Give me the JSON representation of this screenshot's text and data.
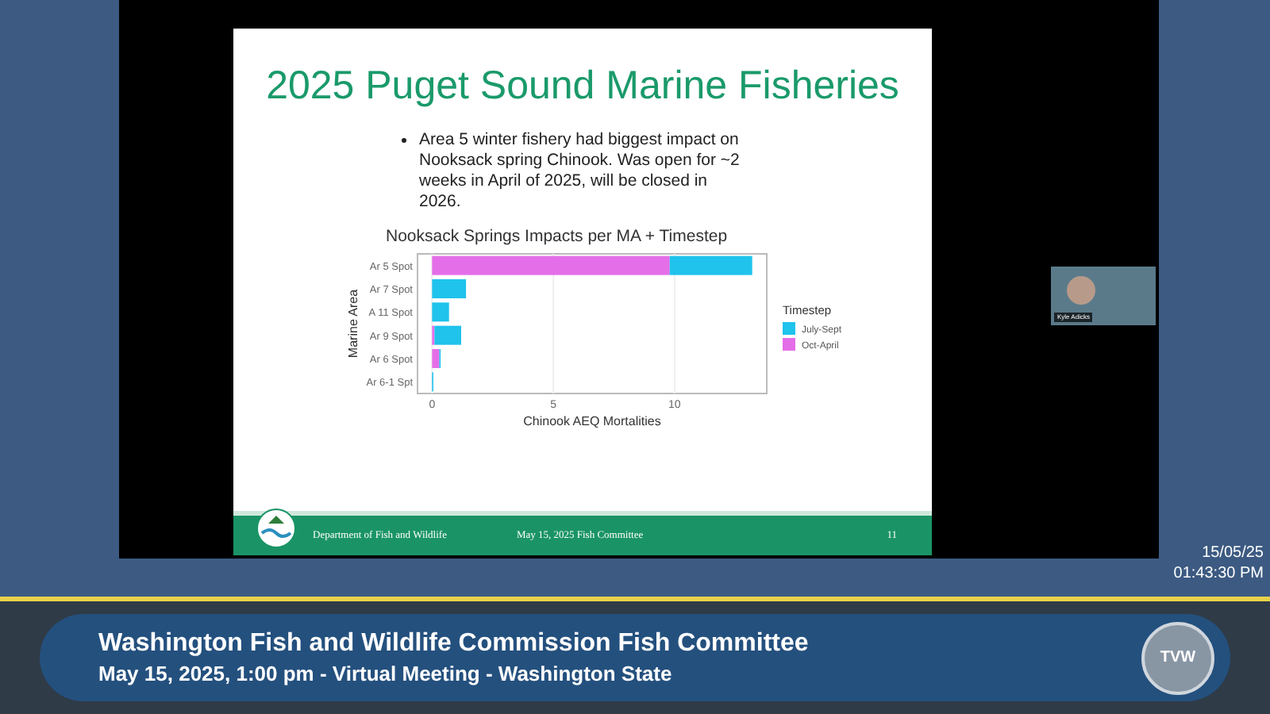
{
  "slide": {
    "title": "2025 Puget Sound Marine Fisheries",
    "bullets": [
      "Area 5 winter fishery had biggest impact on Nooksack spring Chinook.  Was open for ~2 weeks in April of 2025, will be closed in 2026."
    ],
    "chart_data": {
      "type": "bar",
      "title": "Nooksack Springs Impacts per MA + Timestep",
      "xlabel": "Chinook AEQ Mortalities",
      "ylabel": "Marine Area",
      "orientation": "horizontal",
      "stacked": true,
      "categories": [
        "Ar 5 Spot",
        "Ar 7 Spot",
        "A 11 Spot",
        "Ar 9 Spot",
        "Ar 6 Spot",
        "Ar 6-1 Spt"
      ],
      "series": [
        {
          "name": "July-Sept",
          "color": "#1fc3ec",
          "values": [
            3.4,
            1.4,
            0.7,
            1.1,
            0.05,
            0.05
          ]
        },
        {
          "name": "Oct-April",
          "color": "#e46ee8",
          "values": [
            9.8,
            0,
            0,
            0.1,
            0.3,
            0
          ]
        }
      ],
      "xlim": [
        -0.6,
        13.8
      ],
      "xticks": [
        0,
        5,
        10
      ],
      "grid": true,
      "legend": {
        "title": "Timestep"
      }
    },
    "footer": {
      "org": "Department of Fish and Wildlife",
      "meeting": "May 15, 2025 Fish Committee",
      "page": "11"
    }
  },
  "participant": {
    "name": "Kyle Adicks"
  },
  "timestamp": {
    "date": "15/05/25",
    "time": "01:43:30 PM"
  },
  "banner": {
    "title": "Washington Fish and Wildlife Commission Fish Committee",
    "subtitle": "May 15, 2025, 1:00 pm - Virtual Meeting - Washington State",
    "logo_text": "TVW"
  }
}
